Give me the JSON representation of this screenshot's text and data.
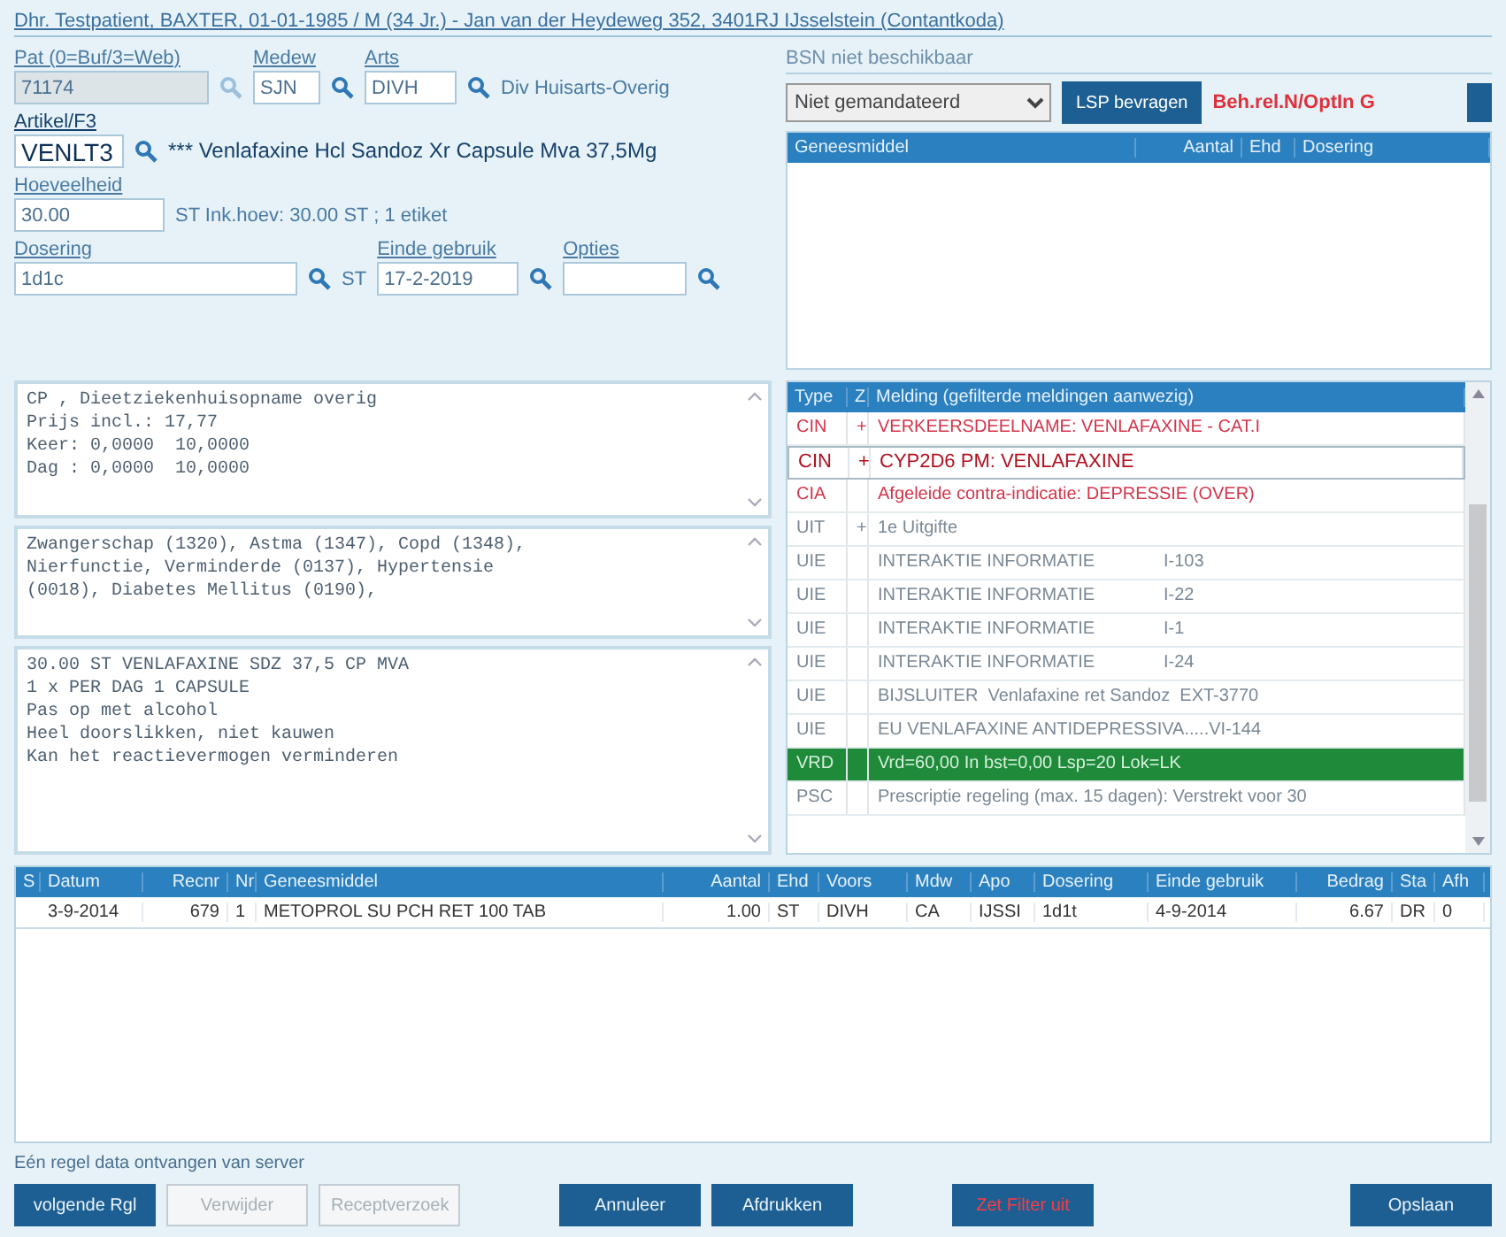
{
  "patient_link": "Dhr. Testpatient, BAXTER, 01-01-1985 / M (34 Jr.) - Jan van der Heydeweg 352, 3401RJ IJsselstein (Contantkoda)",
  "form": {
    "pat": {
      "label": "Pat (0=Buf/3=Web)",
      "value": "71174",
      "disabled": true
    },
    "medew": {
      "label": "Medew",
      "value": "SJN"
    },
    "arts": {
      "label": "Arts",
      "value": "DIVH",
      "name": "Div Huisarts-Overig"
    },
    "artikel": {
      "label": "Artikel/F3",
      "value": "VENLT3",
      "name": "*** Venlafaxine Hcl Sandoz Xr Capsule Mva 37,5Mg"
    },
    "hoeveelheid": {
      "label": "Hoeveelheid",
      "value": "30.00",
      "info": "ST Ink.hoev: 30.00 ST ; 1 etiket"
    },
    "dosering": {
      "label": "Dosering",
      "value": "1d1c",
      "unit": "ST"
    },
    "einde": {
      "label": "Einde gebruik",
      "value": "17-2-2019"
    },
    "opties": {
      "label": "Opties"
    }
  },
  "lsp": {
    "bsn": "BSN niet beschikbaar",
    "select": "Niet gemandateerd",
    "button": "LSP bevragen",
    "status": "Beh.rel.N/OptIn G"
  },
  "lsp_table": {
    "columns": [
      "Geneesmiddel",
      "Aantal",
      "Ehd",
      "Dosering"
    ]
  },
  "text_boxes": [
    [
      "CP , Dieetziekenhuisopname overig",
      "Prijs incl.: 17,77",
      "Keer: 0,0000  10,0000",
      "Dag : 0,0000  10,0000"
    ],
    [
      "Zwangerschap (1320), Astma (1347), Copd (1348),",
      "Nierfunctie, Verminderde (0137), Hypertensie",
      "(0018), Diabetes Mellitus (0190),"
    ],
    [
      "30.00 ST VENLAFAXINE SDZ 37,5 CP MVA",
      "1 x PER DAG 1 CAPSULE",
      "Pas op met alcohol",
      "Heel doorslikken, niet kauwen",
      "Kan het reactievermogen verminderen"
    ]
  ],
  "alerts": {
    "columns": [
      "Type",
      "Z",
      "Melding (gefilterde meldingen aanwezig)"
    ],
    "rows": [
      {
        "type": "CIN",
        "z": "+",
        "text": "VERKEERSDEELNAME: VENLAFAXINE - CAT.I",
        "kind": "warning",
        "selected": false
      },
      {
        "type": "CIN",
        "z": "+",
        "text": "CYP2D6 PM: VENLAFAXINE",
        "kind": "warning",
        "selected": true
      },
      {
        "type": "CIA",
        "z": "",
        "text": "Afgeleide contra-indicatie: DEPRESSIE (OVER)",
        "kind": "warning",
        "selected": false
      },
      {
        "type": "UIT",
        "z": "+",
        "text": "1e Uitgifte",
        "kind": "info",
        "selected": false
      },
      {
        "type": "UIE",
        "z": "",
        "text": "INTERAKTIE INFORMATIE              I-103",
        "kind": "info",
        "selected": false
      },
      {
        "type": "UIE",
        "z": "",
        "text": "INTERAKTIE INFORMATIE              I-22",
        "kind": "info",
        "selected": false
      },
      {
        "type": "UIE",
        "z": "",
        "text": "INTERAKTIE INFORMATIE              I-1",
        "kind": "info",
        "selected": false
      },
      {
        "type": "UIE",
        "z": "",
        "text": "INTERAKTIE INFORMATIE              I-24",
        "kind": "info",
        "selected": false
      },
      {
        "type": "UIE",
        "z": "",
        "text": "BIJSLUITER  Venlafaxine ret Sandoz  EXT-3770",
        "kind": "info",
        "selected": false
      },
      {
        "type": "UIE",
        "z": "",
        "text": "EU VENLAFAXINE ANTIDEPRESSIVA.....VI-144",
        "kind": "info",
        "selected": false
      },
      {
        "type": "VRD",
        "z": "",
        "text": "Vrd=60,00 In bst=0,00 Lsp=20 Lok=LK",
        "kind": "ok",
        "selected": false
      },
      {
        "type": "PSC",
        "z": "",
        "text": "Prescriptie regeling (max. 15 dagen): Verstrekt voor 30",
        "kind": "info",
        "selected": false
      }
    ]
  },
  "history": {
    "columns": [
      "S",
      "Datum",
      "Recnr",
      "Nr",
      "Geneesmiddel",
      "Aantal",
      "Ehd",
      "Voors",
      "Mdw",
      "Apo",
      "Dosering",
      "Einde gebruik",
      "Bedrag",
      "Sta",
      "Afh"
    ],
    "rows": [
      [
        "",
        "3-9-2014",
        "679",
        "1",
        "METOPROL SU PCH RET 100 TAB",
        "1.00",
        "ST",
        "DIVH",
        "CA",
        "IJSSI",
        "1d1t",
        "4-9-2014",
        "6.67",
        "DR",
        "0"
      ]
    ]
  },
  "status_bar": "Eén regel data ontvangen van server",
  "buttons": [
    {
      "label": "volgende Rgl",
      "disabled": false,
      "kind": "normal"
    },
    {
      "label": "Verwijder",
      "disabled": true,
      "kind": "normal"
    },
    {
      "label": "Receptverzoek",
      "disabled": true,
      "kind": "normal"
    },
    {
      "label": "Annuleer",
      "disabled": false,
      "kind": "normal"
    },
    {
      "label": "Afdrukken",
      "disabled": false,
      "kind": "normal"
    },
    {
      "label": "Zet Filter uit",
      "disabled": false,
      "kind": "alert"
    },
    {
      "label": "Opslaan",
      "disabled": false,
      "kind": "normal"
    }
  ]
}
